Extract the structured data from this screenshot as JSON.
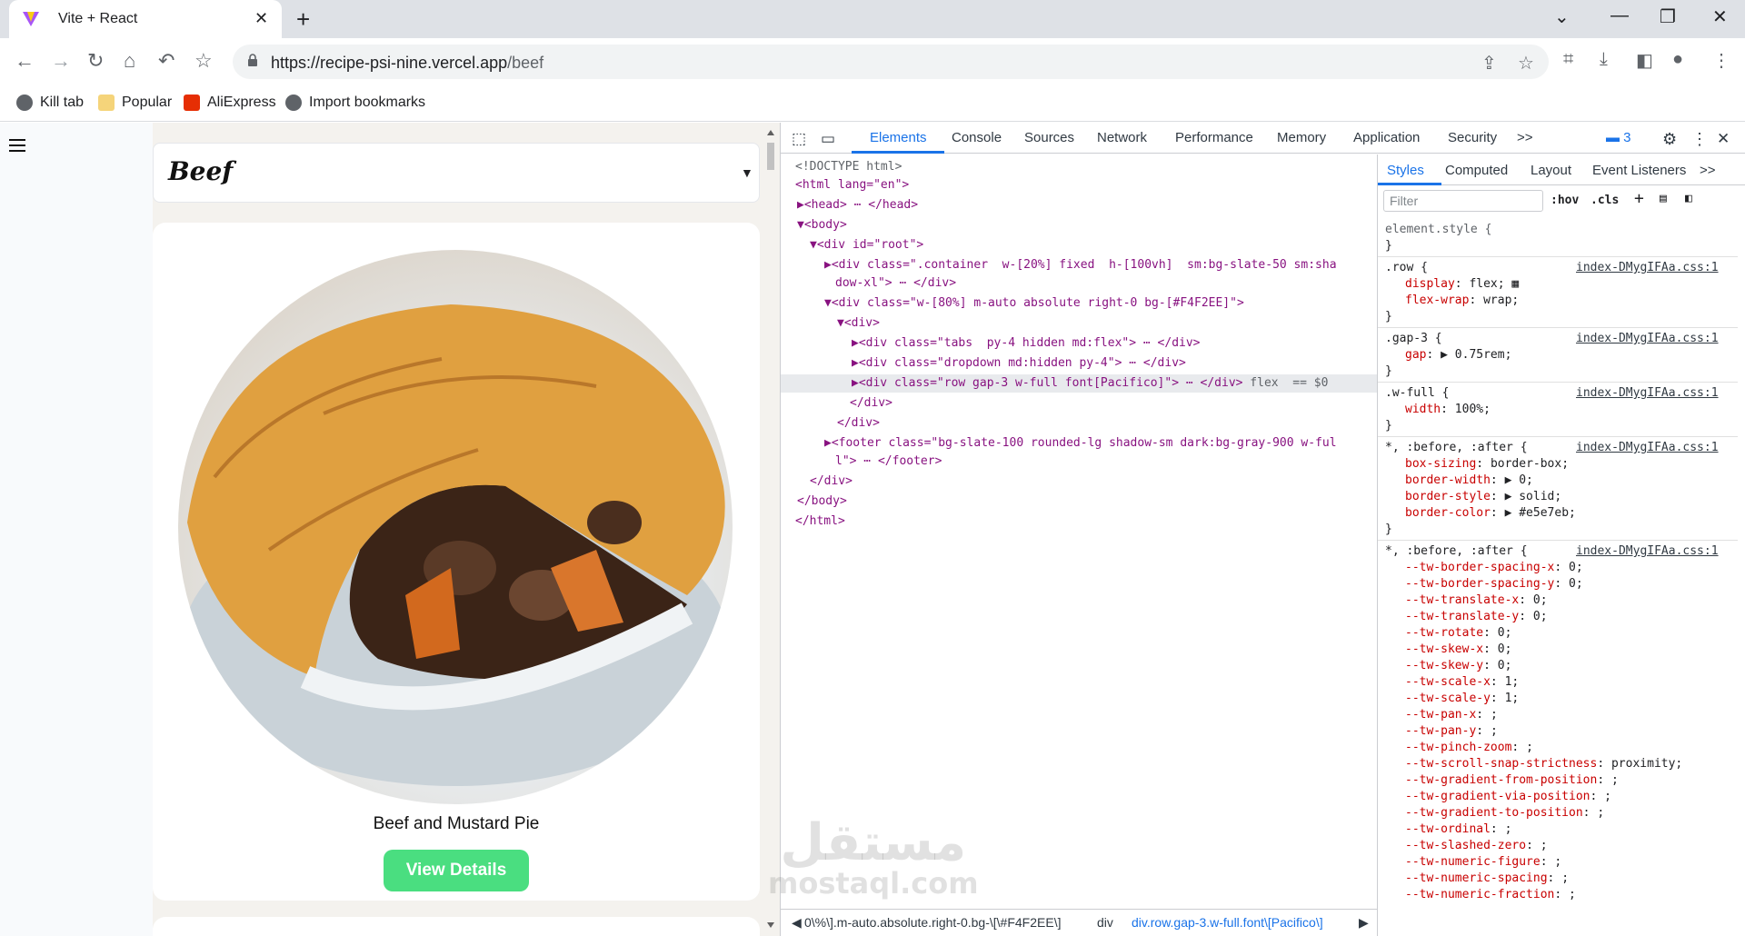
{
  "browser": {
    "tab_title": "Vite + React",
    "url_host": "https://recipe-psi-nine.vercel.app",
    "url_path": "/beef",
    "bookmarks": [
      "Kill tab",
      "Popular",
      "AliExpress",
      "Import bookmarks"
    ]
  },
  "page": {
    "category": "Beef",
    "recipe_name": "Beef and Mustard Pie",
    "view_label": "View Details"
  },
  "devtools": {
    "tabs": [
      "Elements",
      "Console",
      "Sources",
      "Network",
      "Performance",
      "Memory",
      "Application",
      "Security"
    ],
    "more": ">>",
    "issues": "3",
    "dom": [
      "<!DOCTYPE html>",
      "<html lang=\"en\">",
      "<head> ⋯ </head>",
      "<body>",
      "<div id=\"root\">",
      "<div class=\".container  w-[20%] fixed  h-[100vh]  sm:bg-slate-50 sm:sha",
      "dow-xl\"> ⋯ </div>",
      "<div class=\"w-[80%] m-auto absolute right-0 bg-[#F4F2EE]\">",
      "<div>",
      "<div class=\"tabs  py-4 hidden md:flex\"> ⋯ </div>",
      "<div class=\"dropdown md:hidden py-4\"> ⋯ </div>",
      "<div class=\"row gap-3 w-full font[Pacifico]\"> ⋯ </div>",
      "</div>",
      "</div>",
      "<footer class=\"bg-slate-100 rounded-lg shadow-sm dark:bg-gray-900 w-ful",
      "l\"> ⋯ </footer>",
      "</div>",
      "</body>",
      "</html>"
    ],
    "selected_suffix": "flex  == $0",
    "crumbs": [
      "0\\%\\].m-auto.absolute.right-0.bg-\\[\\#F4F2EE\\]",
      "div",
      "div.row.gap-3.w-full.font\\[Pacifico\\]"
    ],
    "styles_tabs": [
      "Styles",
      "Computed",
      "Layout",
      "Event Listeners"
    ],
    "filter_placeholder": "Filter",
    "hov": ":hov",
    "cls": ".cls",
    "source": "index-DMygIFAa.css:1",
    "rules": [
      {
        "sel": "element.style {",
        "props": []
      },
      {
        "sel": ".row {",
        "props": [
          [
            "display",
            "flex;"
          ],
          [
            "flex-wrap",
            "wrap;"
          ]
        ]
      },
      {
        "sel": ".gap-3 {",
        "props": [
          [
            "gap",
            "▶ 0.75rem;"
          ]
        ]
      },
      {
        "sel": ".w-full {",
        "props": [
          [
            "width",
            "100%;"
          ]
        ]
      },
      {
        "sel": "*, :before, :after {",
        "props": [
          [
            "box-sizing",
            "border-box;"
          ],
          [
            "border-width",
            "▶ 0;"
          ],
          [
            "border-style",
            "▶ solid;"
          ],
          [
            "border-color",
            "▶ #e5e7eb;"
          ]
        ]
      },
      {
        "sel": "*, :before, :after {",
        "props": [
          [
            "--tw-border-spacing-x",
            "0;"
          ],
          [
            "--tw-border-spacing-y",
            "0;"
          ],
          [
            "--tw-translate-x",
            "0;"
          ],
          [
            "--tw-translate-y",
            "0;"
          ],
          [
            "--tw-rotate",
            "0;"
          ],
          [
            "--tw-skew-x",
            "0;"
          ],
          [
            "--tw-skew-y",
            "0;"
          ],
          [
            "--tw-scale-x",
            "1;"
          ],
          [
            "--tw-scale-y",
            "1;"
          ],
          [
            "--tw-pan-x",
            ";"
          ],
          [
            "--tw-pan-y",
            ";"
          ],
          [
            "--tw-pinch-zoom",
            ";"
          ],
          [
            "--tw-scroll-snap-strictness",
            "proximity;"
          ],
          [
            "--tw-gradient-from-position",
            ";"
          ],
          [
            "--tw-gradient-via-position",
            ";"
          ],
          [
            "--tw-gradient-to-position",
            ";"
          ],
          [
            "--tw-ordinal",
            ";"
          ],
          [
            "--tw-slashed-zero",
            ";"
          ],
          [
            "--tw-numeric-figure",
            ";"
          ],
          [
            "--tw-numeric-spacing",
            ";"
          ],
          [
            "--tw-numeric-fraction",
            ";"
          ]
        ]
      }
    ]
  },
  "watermark": {
    "arabic": "مستقل",
    "latin": "mostaql.com"
  }
}
